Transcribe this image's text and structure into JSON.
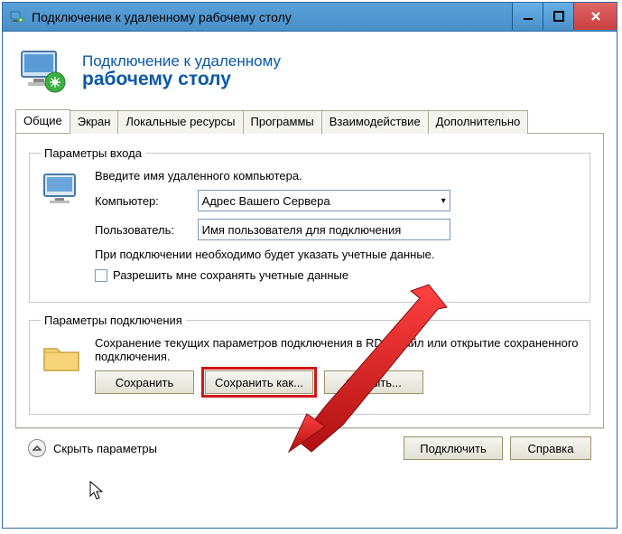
{
  "titlebar": {
    "text": "Подключение к удаленному рабочему столу"
  },
  "header": {
    "line1": "Подключение к удаленному",
    "line2": "рабочему столу"
  },
  "tabs": [
    "Общие",
    "Экран",
    "Локальные ресурсы",
    "Программы",
    "Взаимодействие",
    "Дополнительно"
  ],
  "login_group": {
    "legend": "Параметры входа",
    "intro": "Введите имя удаленного компьютера.",
    "computer_label": "Компьютер:",
    "computer_value": "Адрес Вашего Сервера",
    "user_label": "Пользователь:",
    "user_value": "Имя пользователя для подключения",
    "creds_note": "При подключении необходимо будет указать учетные данные.",
    "allow_save": "Разрешить мне сохранять учетные данные"
  },
  "conn_group": {
    "legend": "Параметры подключения",
    "note": "Сохранение текущих параметров подключения в RDP-файл или открытие сохраненного подключения.",
    "btn_save": "Сохранить",
    "btn_saveas": "Сохранить как...",
    "btn_open": "Открыть..."
  },
  "bottom": {
    "hide": "Скрыть параметры",
    "connect": "Подключить",
    "help": "Справка"
  }
}
